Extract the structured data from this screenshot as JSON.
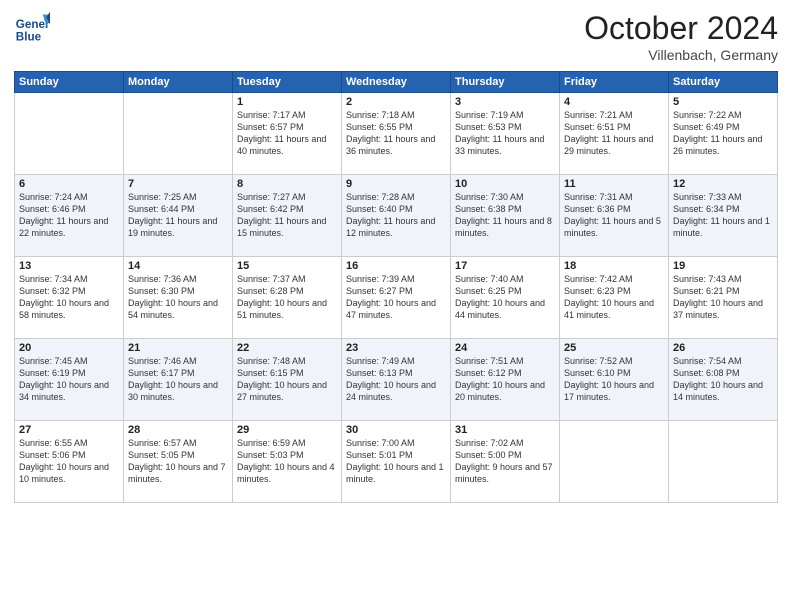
{
  "header": {
    "logo_line1": "General",
    "logo_line2": "Blue",
    "month": "October 2024",
    "location": "Villenbach, Germany"
  },
  "weekdays": [
    "Sunday",
    "Monday",
    "Tuesday",
    "Wednesday",
    "Thursday",
    "Friday",
    "Saturday"
  ],
  "weeks": [
    [
      {
        "day": "",
        "info": ""
      },
      {
        "day": "",
        "info": ""
      },
      {
        "day": "1",
        "info": "Sunrise: 7:17 AM\nSunset: 6:57 PM\nDaylight: 11 hours and 40 minutes."
      },
      {
        "day": "2",
        "info": "Sunrise: 7:18 AM\nSunset: 6:55 PM\nDaylight: 11 hours and 36 minutes."
      },
      {
        "day": "3",
        "info": "Sunrise: 7:19 AM\nSunset: 6:53 PM\nDaylight: 11 hours and 33 minutes."
      },
      {
        "day": "4",
        "info": "Sunrise: 7:21 AM\nSunset: 6:51 PM\nDaylight: 11 hours and 29 minutes."
      },
      {
        "day": "5",
        "info": "Sunrise: 7:22 AM\nSunset: 6:49 PM\nDaylight: 11 hours and 26 minutes."
      }
    ],
    [
      {
        "day": "6",
        "info": "Sunrise: 7:24 AM\nSunset: 6:46 PM\nDaylight: 11 hours and 22 minutes."
      },
      {
        "day": "7",
        "info": "Sunrise: 7:25 AM\nSunset: 6:44 PM\nDaylight: 11 hours and 19 minutes."
      },
      {
        "day": "8",
        "info": "Sunrise: 7:27 AM\nSunset: 6:42 PM\nDaylight: 11 hours and 15 minutes."
      },
      {
        "day": "9",
        "info": "Sunrise: 7:28 AM\nSunset: 6:40 PM\nDaylight: 11 hours and 12 minutes."
      },
      {
        "day": "10",
        "info": "Sunrise: 7:30 AM\nSunset: 6:38 PM\nDaylight: 11 hours and 8 minutes."
      },
      {
        "day": "11",
        "info": "Sunrise: 7:31 AM\nSunset: 6:36 PM\nDaylight: 11 hours and 5 minutes."
      },
      {
        "day": "12",
        "info": "Sunrise: 7:33 AM\nSunset: 6:34 PM\nDaylight: 11 hours and 1 minute."
      }
    ],
    [
      {
        "day": "13",
        "info": "Sunrise: 7:34 AM\nSunset: 6:32 PM\nDaylight: 10 hours and 58 minutes."
      },
      {
        "day": "14",
        "info": "Sunrise: 7:36 AM\nSunset: 6:30 PM\nDaylight: 10 hours and 54 minutes."
      },
      {
        "day": "15",
        "info": "Sunrise: 7:37 AM\nSunset: 6:28 PM\nDaylight: 10 hours and 51 minutes."
      },
      {
        "day": "16",
        "info": "Sunrise: 7:39 AM\nSunset: 6:27 PM\nDaylight: 10 hours and 47 minutes."
      },
      {
        "day": "17",
        "info": "Sunrise: 7:40 AM\nSunset: 6:25 PM\nDaylight: 10 hours and 44 minutes."
      },
      {
        "day": "18",
        "info": "Sunrise: 7:42 AM\nSunset: 6:23 PM\nDaylight: 10 hours and 41 minutes."
      },
      {
        "day": "19",
        "info": "Sunrise: 7:43 AM\nSunset: 6:21 PM\nDaylight: 10 hours and 37 minutes."
      }
    ],
    [
      {
        "day": "20",
        "info": "Sunrise: 7:45 AM\nSunset: 6:19 PM\nDaylight: 10 hours and 34 minutes."
      },
      {
        "day": "21",
        "info": "Sunrise: 7:46 AM\nSunset: 6:17 PM\nDaylight: 10 hours and 30 minutes."
      },
      {
        "day": "22",
        "info": "Sunrise: 7:48 AM\nSunset: 6:15 PM\nDaylight: 10 hours and 27 minutes."
      },
      {
        "day": "23",
        "info": "Sunrise: 7:49 AM\nSunset: 6:13 PM\nDaylight: 10 hours and 24 minutes."
      },
      {
        "day": "24",
        "info": "Sunrise: 7:51 AM\nSunset: 6:12 PM\nDaylight: 10 hours and 20 minutes."
      },
      {
        "day": "25",
        "info": "Sunrise: 7:52 AM\nSunset: 6:10 PM\nDaylight: 10 hours and 17 minutes."
      },
      {
        "day": "26",
        "info": "Sunrise: 7:54 AM\nSunset: 6:08 PM\nDaylight: 10 hours and 14 minutes."
      }
    ],
    [
      {
        "day": "27",
        "info": "Sunrise: 6:55 AM\nSunset: 5:06 PM\nDaylight: 10 hours and 10 minutes."
      },
      {
        "day": "28",
        "info": "Sunrise: 6:57 AM\nSunset: 5:05 PM\nDaylight: 10 hours and 7 minutes."
      },
      {
        "day": "29",
        "info": "Sunrise: 6:59 AM\nSunset: 5:03 PM\nDaylight: 10 hours and 4 minutes."
      },
      {
        "day": "30",
        "info": "Sunrise: 7:00 AM\nSunset: 5:01 PM\nDaylight: 10 hours and 1 minute."
      },
      {
        "day": "31",
        "info": "Sunrise: 7:02 AM\nSunset: 5:00 PM\nDaylight: 9 hours and 57 minutes."
      },
      {
        "day": "",
        "info": ""
      },
      {
        "day": "",
        "info": ""
      }
    ]
  ]
}
